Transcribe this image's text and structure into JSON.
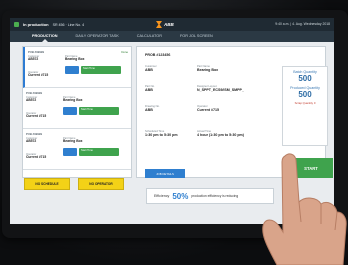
{
  "topbar": {
    "status": "In production",
    "info": "SR 456 · Line No. 4",
    "logo": "ABB",
    "datetime": "9:40 a.m. | 4. Aug. Wednesday 2018"
  },
  "tabs": [
    {
      "label": "PRODUCTION"
    },
    {
      "label": "DAILY OPERATOR TASK"
    },
    {
      "label": "CALCULATOR"
    },
    {
      "label": "FOR JOL SCREEN"
    }
  ],
  "jobs": [
    {
      "tag": "PUB #99999",
      "hdr": "Done",
      "k1": "Customer",
      "v1": "AB572",
      "k2": "Part Name",
      "v2": "Bearing Box",
      "k3": "Operator",
      "v3": "Current #715",
      "pill": "Start Time"
    },
    {
      "tag": "PUB #99999",
      "hdr": "",
      "k1": "Customer",
      "v1": "AB572",
      "k2": "Part Name",
      "v2": "Bearing Box",
      "k3": "Operator",
      "v3": "Current #715",
      "pill": "Start Time"
    },
    {
      "tag": "PUB #99999",
      "hdr": "",
      "k1": "Customer",
      "v1": "AB572",
      "k2": "Part Name",
      "v2": "Bearing Box",
      "k3": "Operator",
      "v3": "Current #715",
      "pill": "Start Time"
    }
  ],
  "detail": {
    "head": "PROB #123456",
    "customer_k": "Customer",
    "customer": "ABB",
    "part_k": "Part Name",
    "part": "Bearing Box",
    "partno_k": "Part No.",
    "partno": "ABB",
    "dl_k": "Designer Layout",
    "dl": "N_SPPT_ECS9/ISM_SMPP_",
    "drawing_k": "Drawing No.",
    "drawing": "ABB",
    "op_k": "Operator",
    "op": "Current #715",
    "sched_k": "Scheduled Time",
    "sched": "1:30 pm to 5:30 pm",
    "actual_k": "Actual Time",
    "actual": "4 hour (1:30 pm to 5:30 pm)",
    "jobinfo": "JOB DETAILS"
  },
  "qty": {
    "target_label": "Batch Quantity",
    "target": "500",
    "produced_label": "Produced Quantity",
    "produced": "500",
    "scrap": "Scrap Quantity  0"
  },
  "start": "START",
  "buttons": {
    "no_schedule": "NO SCHEDULE",
    "no_operator": "NO OPERATOR"
  },
  "efficiency": {
    "label": "Efficiency",
    "value": "50%",
    "text": "production efficiency is reducing"
  }
}
